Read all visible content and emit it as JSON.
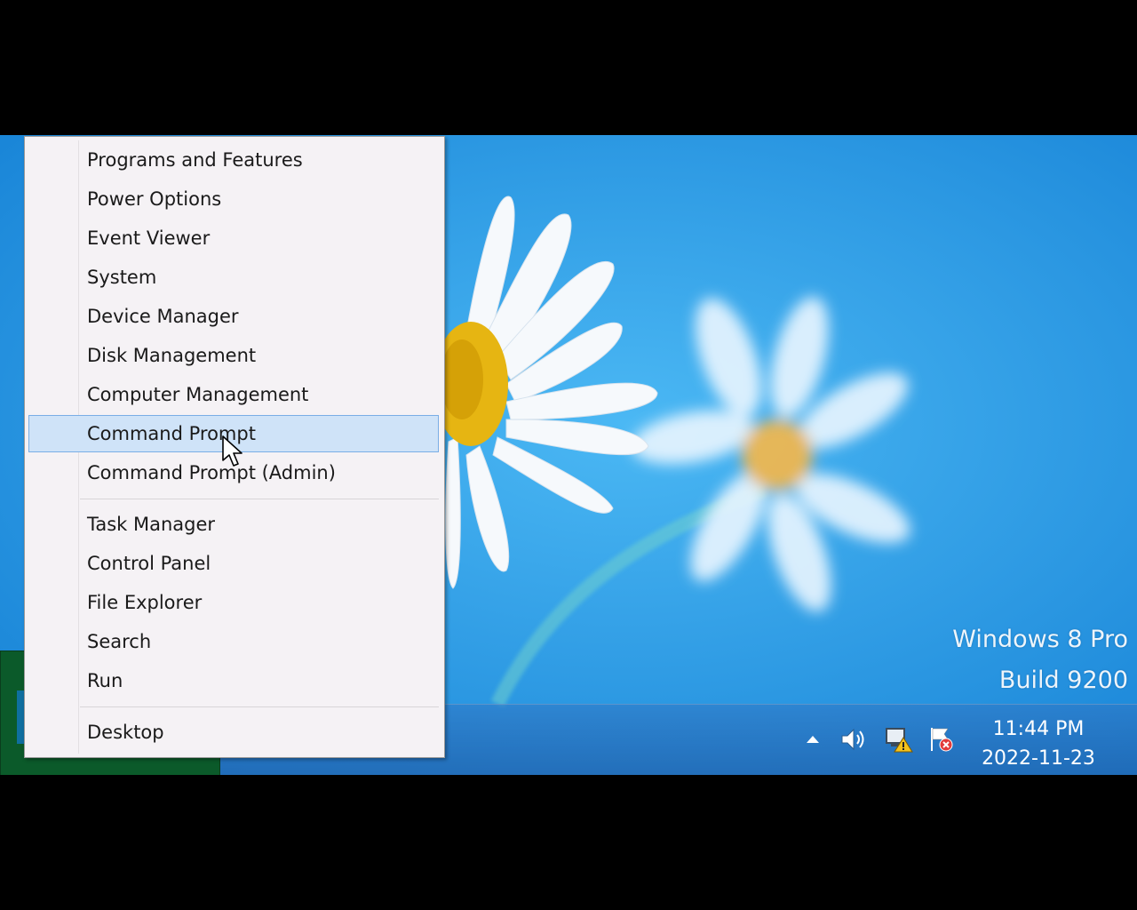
{
  "menu": {
    "items": [
      {
        "label": "Programs and Features"
      },
      {
        "label": "Power Options"
      },
      {
        "label": "Event Viewer"
      },
      {
        "label": "System"
      },
      {
        "label": "Device Manager"
      },
      {
        "label": "Disk Management"
      },
      {
        "label": "Computer Management"
      },
      {
        "label": "Command Prompt"
      },
      {
        "label": "Command Prompt (Admin)"
      },
      {
        "label": "Task Manager"
      },
      {
        "label": "Control Panel"
      },
      {
        "label": "File Explorer"
      },
      {
        "label": "Search"
      },
      {
        "label": "Run"
      },
      {
        "label": "Desktop"
      }
    ],
    "selected_label": "Command Prompt"
  },
  "desktop": {
    "watermark_line1": "Windows 8 Pro",
    "watermark_line2": "Build 9200"
  },
  "tray": {
    "icons": [
      "show-hidden-icons-arrow-icon",
      "volume-icon",
      "network-warning-icon",
      "action-center-flag-icon"
    ],
    "time": "11:44 PM",
    "date": "2022-11-23"
  },
  "colors": {
    "desktop_blue": "#2ea2ec",
    "menu_background": "#f5f2f5",
    "selection_fill": "#cfe3f8",
    "selection_border": "#7aaee6",
    "start_tile_green": "#0b5a2a"
  }
}
